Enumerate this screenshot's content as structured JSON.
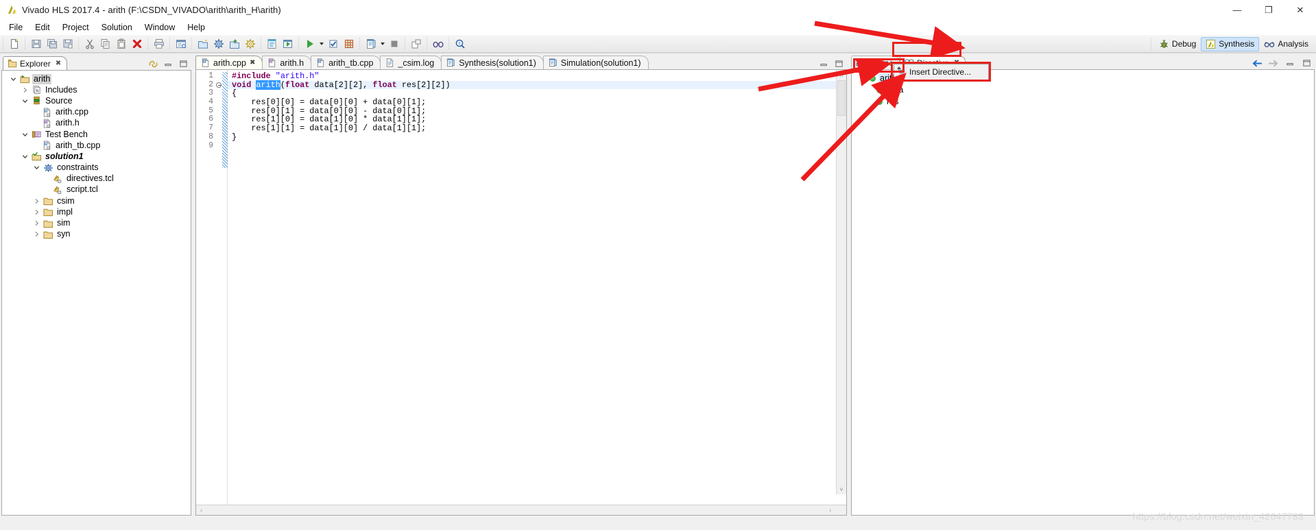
{
  "window": {
    "title": "Vivado HLS 2017.4 - arith (F:\\CSDN_VIVADO\\arith\\arith_H\\arith)",
    "app_icon": "vivado-logo-icon",
    "minimize": "—",
    "maximize": "❐",
    "close": "✕"
  },
  "menubar": {
    "items": [
      {
        "label": "File"
      },
      {
        "label": "Edit"
      },
      {
        "label": "Project"
      },
      {
        "label": "Solution"
      },
      {
        "label": "Window"
      },
      {
        "label": "Help"
      }
    ]
  },
  "toolbar": {
    "groups": [
      {
        "buttons": [
          {
            "icon": "new-file-icon"
          }
        ]
      },
      {
        "buttons": [
          {
            "icon": "save-icon"
          },
          {
            "icon": "save-all-icon"
          },
          {
            "icon": "save-as-icon"
          }
        ]
      },
      {
        "buttons": [
          {
            "icon": "cut-icon"
          },
          {
            "icon": "copy-icon"
          },
          {
            "icon": "paste-icon"
          },
          {
            "icon": "delete-icon"
          }
        ]
      },
      {
        "buttons": [
          {
            "icon": "print-icon"
          }
        ]
      },
      {
        "buttons": [
          {
            "icon": "new-project-wizard-icon"
          }
        ]
      },
      {
        "buttons": [
          {
            "icon": "new-solution-icon"
          },
          {
            "icon": "project-settings-icon"
          },
          {
            "icon": "solution-settings-icon"
          },
          {
            "icon": "run-settings-icon"
          }
        ]
      },
      {
        "buttons": [
          {
            "icon": "open-report-icon"
          },
          {
            "icon": "compare-reports-icon"
          }
        ]
      },
      {
        "buttons": [
          {
            "icon": "run-c-simulation-icon"
          },
          {
            "icon": "run-dropdown-arrow"
          },
          {
            "icon": "c-synthesis-icon"
          },
          {
            "icon": "run-cosim-icon"
          }
        ]
      },
      {
        "buttons": [
          {
            "icon": "export-rtl-icon"
          },
          {
            "icon": "export-dropdown-arrow"
          },
          {
            "icon": "stop-icon"
          }
        ]
      },
      {
        "buttons": [
          {
            "icon": "open-analysis-icon"
          }
        ]
      },
      {
        "buttons": [
          {
            "icon": "binoculars-icon"
          }
        ]
      },
      {
        "buttons": [
          {
            "icon": "search-icon"
          }
        ]
      }
    ]
  },
  "perspectives": {
    "items": [
      {
        "label": "Debug",
        "icon": "debug-bug-icon",
        "active": false
      },
      {
        "label": "Synthesis",
        "icon": "synthesis-icon",
        "active": true
      },
      {
        "label": "Analysis",
        "icon": "analysis-glasses-icon",
        "active": false
      }
    ]
  },
  "explorer": {
    "tab_label": "Explorer",
    "tab_close": "✖",
    "tools": [
      {
        "icon": "link-with-editor-icon"
      },
      {
        "icon": "minimize-panel-icon"
      },
      {
        "icon": "maximize-panel-icon"
      }
    ],
    "tree": [
      {
        "label": "arith",
        "indent": 0,
        "twist": "down",
        "icon": "project-folder-icon",
        "selected": true,
        "italic": false
      },
      {
        "label": "Includes",
        "indent": 1,
        "twist": "right",
        "icon": "includes-icon",
        "selected": false,
        "italic": false
      },
      {
        "label": "Source",
        "indent": 1,
        "twist": "down",
        "icon": "source-folder-icon",
        "selected": false,
        "italic": false
      },
      {
        "label": "arith.cpp",
        "indent": 2,
        "twist": "none",
        "icon": "cpp-file-icon",
        "selected": false,
        "italic": false
      },
      {
        "label": "arith.h",
        "indent": 2,
        "twist": "none",
        "icon": "header-file-icon",
        "selected": false,
        "italic": false
      },
      {
        "label": "Test Bench",
        "indent": 1,
        "twist": "down",
        "icon": "testbench-icon",
        "selected": false,
        "italic": false
      },
      {
        "label": "arith_tb.cpp",
        "indent": 2,
        "twist": "none",
        "icon": "cpp-file-icon",
        "selected": false,
        "italic": false
      },
      {
        "label": "solution1",
        "indent": 1,
        "twist": "down",
        "icon": "solution-folder-icon",
        "selected": false,
        "italic": true
      },
      {
        "label": "constraints",
        "indent": 2,
        "twist": "down",
        "icon": "constraints-gear-icon",
        "selected": false,
        "italic": false
      },
      {
        "label": "directives.tcl",
        "indent": 3,
        "twist": "none",
        "icon": "tcl-file-icon",
        "selected": false,
        "italic": false
      },
      {
        "label": "script.tcl",
        "indent": 3,
        "twist": "none",
        "icon": "tcl-file-icon",
        "selected": false,
        "italic": false
      },
      {
        "label": "csim",
        "indent": 2,
        "twist": "right",
        "icon": "folder-icon",
        "selected": false,
        "italic": false
      },
      {
        "label": "impl",
        "indent": 2,
        "twist": "right",
        "icon": "folder-icon",
        "selected": false,
        "italic": false
      },
      {
        "label": "sim",
        "indent": 2,
        "twist": "right",
        "icon": "folder-icon",
        "selected": false,
        "italic": false
      },
      {
        "label": "syn",
        "indent": 2,
        "twist": "right",
        "icon": "folder-icon",
        "selected": false,
        "italic": false
      }
    ]
  },
  "editor": {
    "tabs": [
      {
        "label": "arith.cpp",
        "icon": "c-file-icon",
        "active": true,
        "close": "✖"
      },
      {
        "label": "arith.h",
        "icon": "h-file-icon",
        "active": false,
        "close": ""
      },
      {
        "label": "arith_tb.cpp",
        "icon": "c-file-icon",
        "active": false,
        "close": ""
      },
      {
        "label": "_csim.log",
        "icon": "log-file-icon",
        "active": false,
        "close": ""
      },
      {
        "label": "Synthesis(solution1)",
        "icon": "report-icon",
        "active": false,
        "close": ""
      },
      {
        "label": "Simulation(solution1)",
        "icon": "report-icon",
        "active": false,
        "close": ""
      }
    ],
    "lines": [
      {
        "n": "1",
        "fold": false,
        "highlight": false,
        "html": "<span class=\"pp\">#include</span> <span class=\"str\">\"arith.h\"</span>"
      },
      {
        "n": "2",
        "fold": true,
        "highlight": true,
        "html": "<span class=\"kw\">void</span> <span class=\"selword\">arith</span>(<span class=\"kw\">float</span> data[2][2], <span class=\"kw\">float</span> res[2][2])"
      },
      {
        "n": "3",
        "fold": false,
        "highlight": false,
        "html": "{"
      },
      {
        "n": "4",
        "fold": false,
        "highlight": false,
        "html": "    res[0][0] = data[0][0] + data[0][1];"
      },
      {
        "n": "5",
        "fold": false,
        "highlight": false,
        "html": "    res[0][1] = data[0][0] - data[0][1];"
      },
      {
        "n": "6",
        "fold": false,
        "highlight": false,
        "html": "    res[1][0] = data[1][0] * data[1][1];"
      },
      {
        "n": "7",
        "fold": false,
        "highlight": false,
        "html": "    res[1][1] = data[1][0] / data[1][1];"
      },
      {
        "n": "8",
        "fold": false,
        "highlight": false,
        "html": "}"
      },
      {
        "n": "9",
        "fold": false,
        "highlight": false,
        "html": ""
      }
    ],
    "plain_text": [
      "#include \"arith.h\"",
      "void arith(float data[2][2], float res[2][2])",
      "{",
      "    res[0][0] = data[0][0] + data[0][1];",
      "    res[0][1] = data[0][0] - data[0][1];",
      "    res[1][0] = data[1][0] * data[1][1];",
      "    res[1][1] = data[1][0] / data[1][1];",
      "}",
      ""
    ],
    "scroll_left": "‹",
    "scroll_right": "›",
    "scroll_up": "˄",
    "scroll_down": "˅"
  },
  "right_panel": {
    "tabs": [
      {
        "label": "Outline",
        "icon": "outline-icon",
        "active": false,
        "close": ""
      },
      {
        "label": "Directive",
        "icon": "directive-icon",
        "active": true,
        "close": "✖"
      }
    ],
    "tools": [
      {
        "icon": "back-arrow-icon"
      },
      {
        "icon": "forward-arrow-icon"
      },
      {
        "icon": "minimize-panel-icon"
      },
      {
        "icon": "maximize-panel-icon"
      }
    ],
    "tree": [
      {
        "label": "arith",
        "indent": 0,
        "twist": "down",
        "icon": "function-dot-icon",
        "selected": true
      },
      {
        "label": "data",
        "indent": 1,
        "twist": "none",
        "icon": "array-dot-icon",
        "selected": false
      },
      {
        "label": "res",
        "indent": 1,
        "twist": "none",
        "icon": "array-dot-icon",
        "selected": false
      }
    ]
  },
  "context_menu": {
    "items": [
      {
        "label": "Insert Directive...",
        "icon": "insert-directive-icon"
      }
    ],
    "scroll_up_indicator": "▴"
  },
  "annotations": {
    "watermark": "https://blog.csdn.net/weixin_42647783",
    "arrow_color": "#ed1c1c",
    "box_color": "#e8231c"
  }
}
